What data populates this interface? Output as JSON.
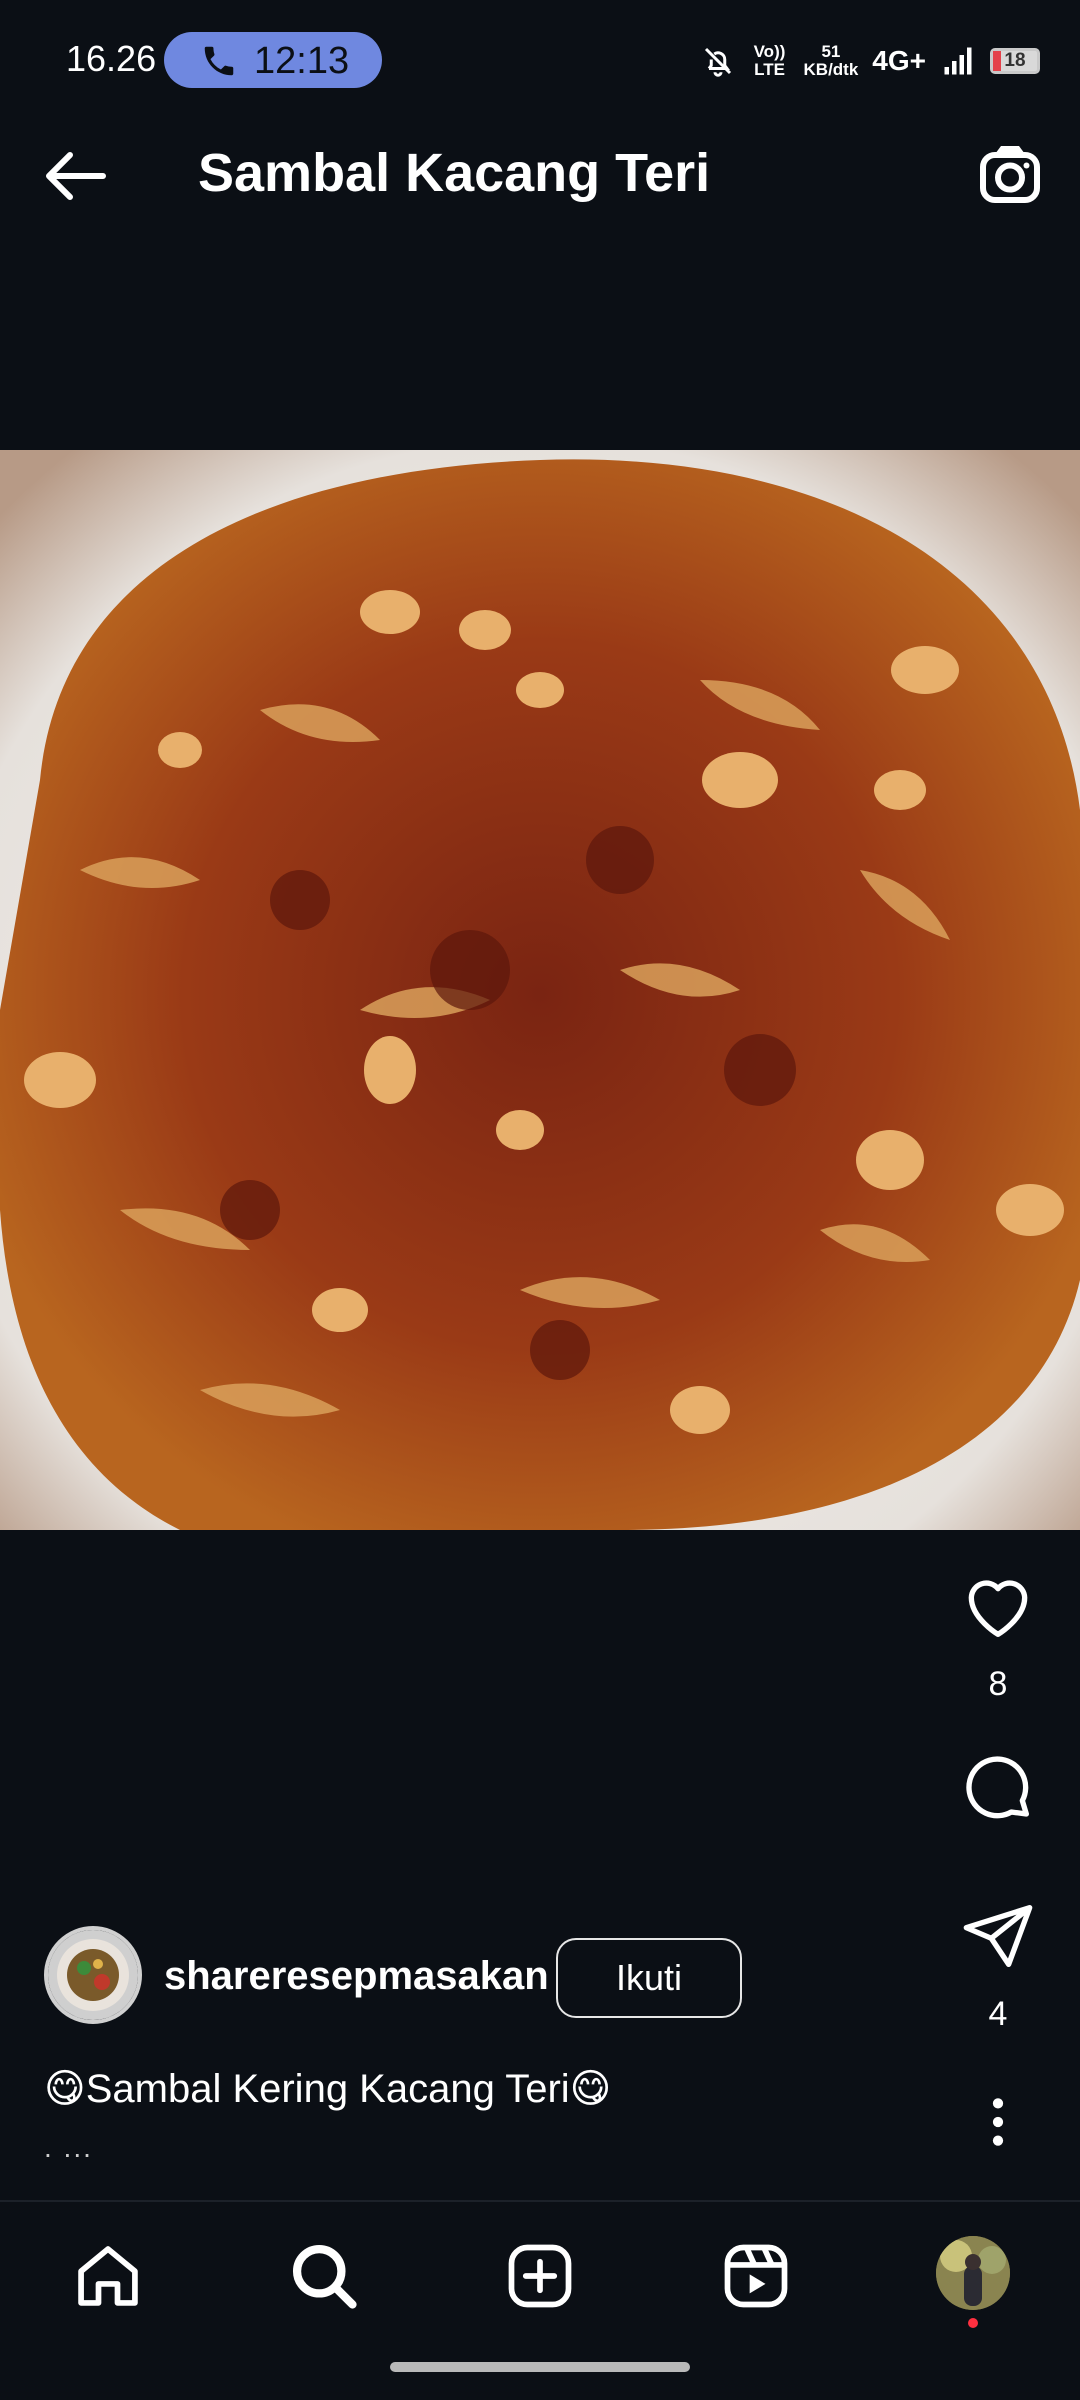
{
  "status_bar": {
    "time": "16.26",
    "call_time": "12:13",
    "volte": "Vo)) LTE",
    "speed_value": "51",
    "speed_unit": "KB/dtk",
    "network": "4G+",
    "battery": "18"
  },
  "header": {
    "title": "Sambal Kacang Teri"
  },
  "post": {
    "like_count": "8",
    "share_count": "4",
    "author": "shareresepmasakan",
    "follow_label": "Ikuti",
    "caption": "😋Sambal Kering Kacang Teri😋",
    "caption_more": ". ..."
  },
  "colors": {
    "background": "#0b0f15",
    "call_pill": "#6f88e0",
    "notification_dot": "#ff3040"
  },
  "icons": {
    "back": "arrow-left-icon",
    "camera": "camera-icon",
    "like": "heart-icon",
    "comment": "comment-icon",
    "share": "send-icon",
    "more": "more-vertical-icon",
    "nav": [
      "home-icon",
      "search-icon",
      "add-icon",
      "reels-icon",
      "profile-avatar"
    ]
  }
}
